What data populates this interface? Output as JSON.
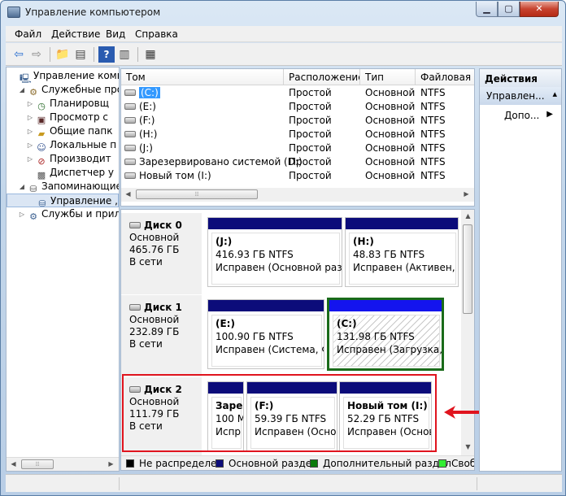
{
  "window": {
    "title": "Управление компьютером"
  },
  "menu": [
    "Файл",
    "Действие",
    "Вид",
    "Справка"
  ],
  "tree": [
    {
      "label": "Управление компь",
      "icon": "computer-icon",
      "level": 0,
      "expander": ""
    },
    {
      "label": "Служебные про",
      "icon": "tools-icon",
      "level": 1,
      "expander": "◢"
    },
    {
      "label": "Планировщ",
      "icon": "clock-icon",
      "level": 2,
      "expander": "▷"
    },
    {
      "label": "Просмотр с",
      "icon": "event-viewer-icon",
      "level": 2,
      "expander": "▷"
    },
    {
      "label": "Общие папк",
      "icon": "shared-folder-icon",
      "level": 2,
      "expander": "▷"
    },
    {
      "label": "Локальные п",
      "icon": "users-icon",
      "level": 2,
      "expander": "▷"
    },
    {
      "label": "Производит",
      "icon": "performance-icon",
      "level": 2,
      "expander": "▷"
    },
    {
      "label": "Диспетчер у",
      "icon": "device-manager-icon",
      "level": 2,
      "expander": ""
    },
    {
      "label": "Запоминающие",
      "icon": "storage-icon",
      "level": 1,
      "expander": "◢"
    },
    {
      "label": "Управление ,",
      "icon": "disk-management-icon",
      "level": 2,
      "expander": ""
    },
    {
      "label": "Службы и прил",
      "icon": "services-icon",
      "level": 1,
      "expander": "▷"
    }
  ],
  "volumes": {
    "columns": [
      "Том",
      "Расположение",
      "Тип",
      "Файловая си"
    ],
    "rows": [
      [
        "(C:)",
        "Простой",
        "Основной",
        "NTFS"
      ],
      [
        "(E:)",
        "Простой",
        "Основной",
        "NTFS"
      ],
      [
        "(F:)",
        "Простой",
        "Основной",
        "NTFS"
      ],
      [
        "(H:)",
        "Простой",
        "Основной",
        "NTFS"
      ],
      [
        "(J:)",
        "Простой",
        "Основной",
        "NTFS"
      ],
      [
        "Зарезервировано системой (D:)",
        "Простой",
        "Основной",
        "NTFS"
      ],
      [
        "Новый том (I:)",
        "Простой",
        "Основной",
        "NTFS"
      ]
    ],
    "selected_row": 0
  },
  "disks": [
    {
      "name": "Диск 0",
      "kind": "Основной",
      "size": "465.76 ГБ",
      "status": "В сети",
      "partitions": [
        {
          "title": "(J:)",
          "size": "416.93 ГБ NTFS",
          "status": "Исправен (Основной раздел"
        },
        {
          "title": "(H:)",
          "size": "48.83 ГБ NTFS",
          "status": "Исправен (Активен, Ос"
        }
      ]
    },
    {
      "name": "Диск 1",
      "kind": "Основной",
      "size": "232.89 ГБ",
      "status": "В сети",
      "partitions": [
        {
          "title": "(E:)",
          "size": "100.90 ГБ NTFS",
          "status": "Исправен (Система, Фа"
        },
        {
          "title": "(C:)",
          "size": "131.98 ГБ NTFS",
          "status": "Исправен (Загрузка, Ав"
        }
      ]
    },
    {
      "name": "Диск 2",
      "kind": "Основной",
      "size": "111.79 ГБ",
      "status": "В сети",
      "partitions": [
        {
          "title": "Зарез",
          "size": "100 М",
          "status": "Испр"
        },
        {
          "title": "(F:)",
          "size": "59.39 ГБ NTFS",
          "status": "Исправен (Основ"
        },
        {
          "title": "Новый том  (I:)",
          "size": "52.29 ГБ NTFS",
          "status": "Исправен (Основ"
        }
      ]
    }
  ],
  "legend": [
    {
      "label": "Не распределен",
      "color": "#000000"
    },
    {
      "label": "Основной раздел",
      "color": "#0c0c7a"
    },
    {
      "label": "Дополнительный раздел",
      "color": "#0a7a0a"
    },
    {
      "label": "Своб",
      "color": "#33ee33"
    }
  ],
  "actions": {
    "header": "Действия",
    "section": "Управлен...",
    "item": "Допо..."
  },
  "colors": {
    "annotation": "#e0141e",
    "selected_partition": "#1a6b1a",
    "primary_bar": "#0c0c7a",
    "selected_bar": "#1414ee"
  }
}
